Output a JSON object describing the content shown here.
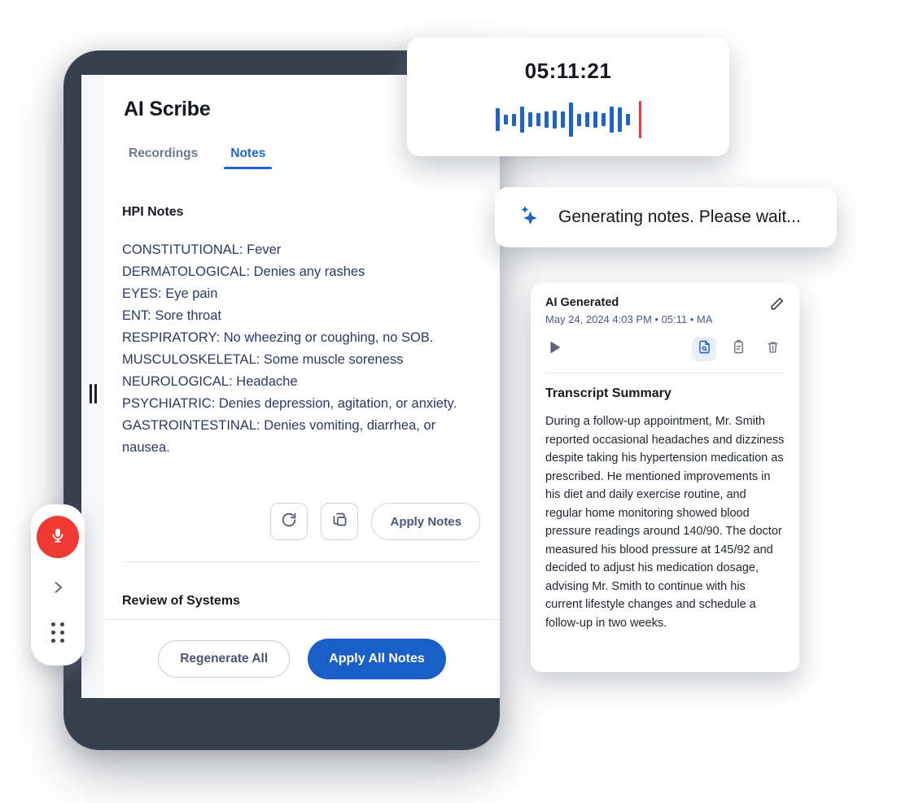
{
  "app": {
    "title": "AI Scribe",
    "tabs": [
      {
        "label": "Recordings",
        "active": false
      },
      {
        "label": "Notes",
        "active": true
      }
    ],
    "hpi_section_title": "HPI Notes",
    "hpi_lines": [
      "CONSTITUTIONAL: Fever",
      "DERMATOLOGICAL: Denies any rashes",
      "EYES: Eye pain",
      "ENT: Sore throat",
      "RESPIRATORY: No wheezing or coughing, no SOB.",
      "MUSCULOSKELETAL: Some muscle soreness",
      "NEUROLOGICAL: Headache",
      "PSYCHIATRIC: Denies depression, agitation, or anxiety.",
      "GASTROINTESTINAL: Denies vomiting, diarrhea, or nausea."
    ],
    "note_actions": {
      "regenerate_icon": "refresh-icon",
      "copy_icon": "copy-icon",
      "apply_label": "Apply Notes"
    },
    "ros_section_title": "Review of Systems",
    "footer": {
      "regenerate_all_label": "Regenerate All",
      "apply_all_label": "Apply All Notes"
    }
  },
  "mic_toolbar": {
    "mic_icon": "microphone-icon",
    "expand_icon": "chevron-right-icon",
    "grip_icon": "drag-grip-icon"
  },
  "timer_card": {
    "time": "05:11:21",
    "waveform": [
      22,
      10,
      12,
      26,
      14,
      13,
      16,
      18,
      16,
      34,
      12,
      14,
      16,
      13,
      26,
      24,
      11
    ],
    "playhead_color": "#f0392f",
    "wave_color": "#1f63c8"
  },
  "toast": {
    "icon": "sparkle-ai-icon",
    "message": "Generating notes. Please wait..."
  },
  "ai_card": {
    "title": "AI Generated",
    "meta": "May 24, 2024 4:03 PM • 05:11 • MA",
    "edit_icon": "pencil-icon",
    "play_icon": "play-icon",
    "tools": [
      {
        "name": "transcript-summary-icon",
        "active": true
      },
      {
        "name": "clipboard-icon",
        "active": false
      },
      {
        "name": "trash-icon",
        "active": false
      }
    ],
    "summary_title": "Transcript Summary",
    "summary_body": "During a follow-up appointment, Mr. Smith reported occasional headaches and dizziness despite taking his hypertension medication as prescribed. He mentioned improvements in his diet and daily exercise routine, and regular home monitoring showed blood pressure readings around 140/90. The doctor measured his blood pressure at 145/92 and decided to adjust his medication dosage, advising Mr. Smith to continue with his current lifestyle changes and schedule a follow-up in two weeks."
  },
  "colors": {
    "accent_blue": "#1a5fc8",
    "note_text_blue": "#2c3a63",
    "frame_dark": "#383f4c",
    "mic_red": "#ef3b33"
  }
}
